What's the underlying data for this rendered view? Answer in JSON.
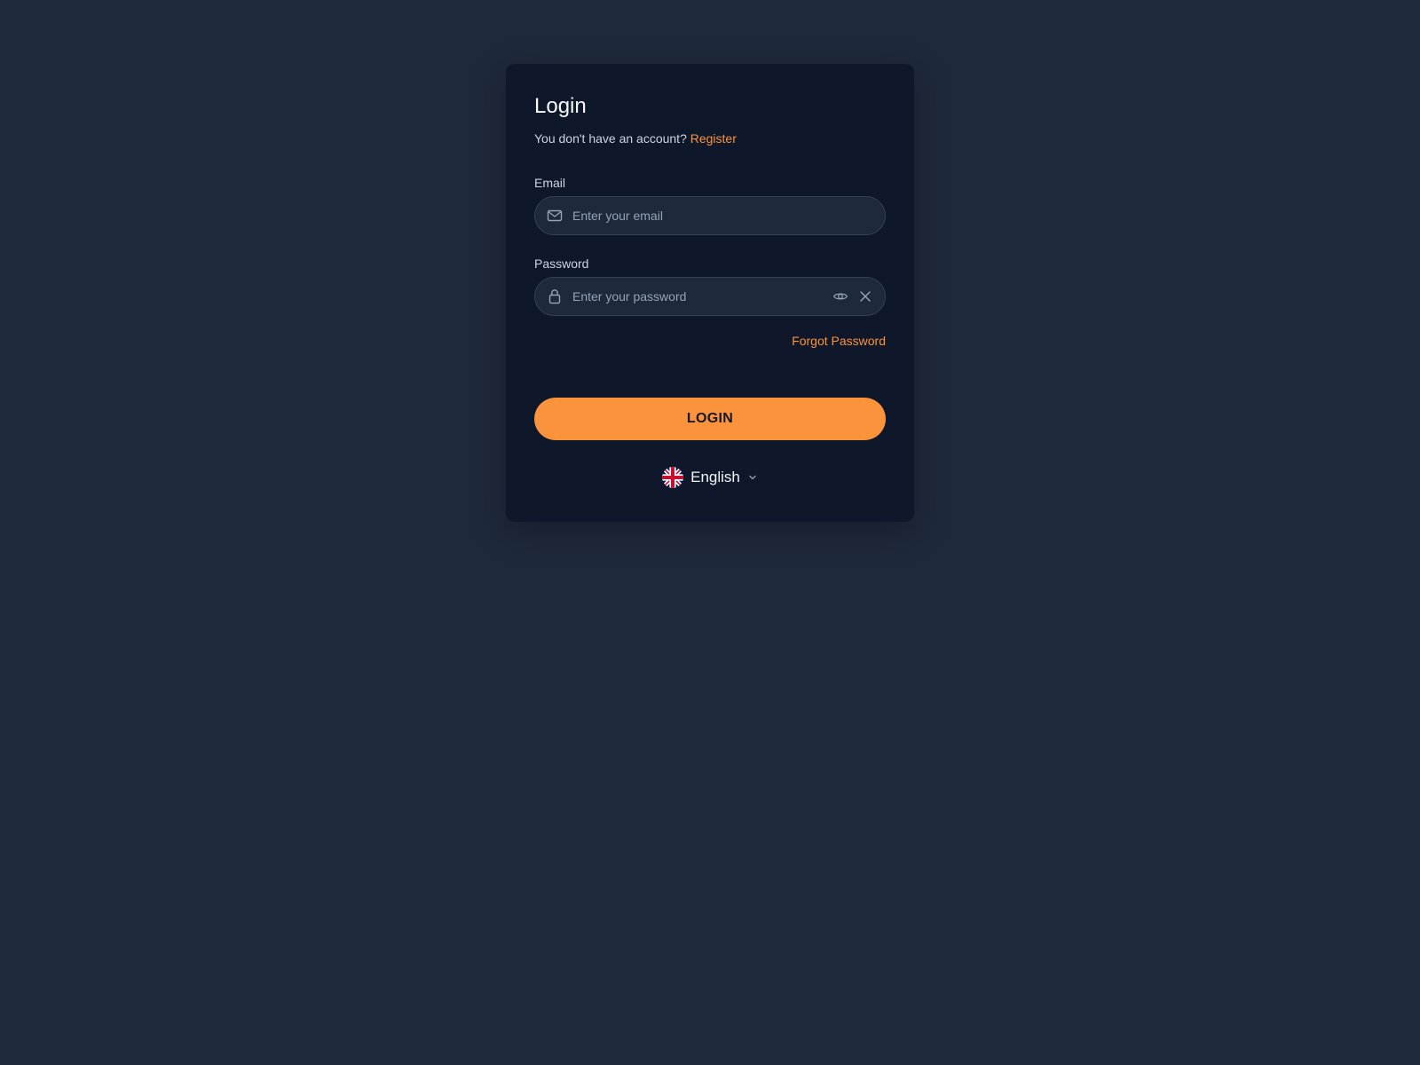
{
  "card": {
    "title": "Login",
    "subtitle_text": "You don't have an account?",
    "register_link": "Register"
  },
  "form": {
    "email": {
      "label": "Email",
      "placeholder": "Enter your email",
      "icon": "mail-icon"
    },
    "password": {
      "label": "Password",
      "placeholder": "Enter your password",
      "icon": "lock-icon",
      "toggle_icon": "eye-icon",
      "clear_icon": "close-icon"
    },
    "forgot_password": "Forgot Password",
    "submit_label": "LOGIN"
  },
  "language": {
    "selected": "English",
    "flag_icon": "uk-flag-icon",
    "dropdown_icon": "chevron-down-icon"
  },
  "colors": {
    "background": "#1e293b",
    "card": "#0f172a",
    "accent": "#fb923c",
    "input_bg": "#1e293b",
    "input_border": "#334155"
  }
}
